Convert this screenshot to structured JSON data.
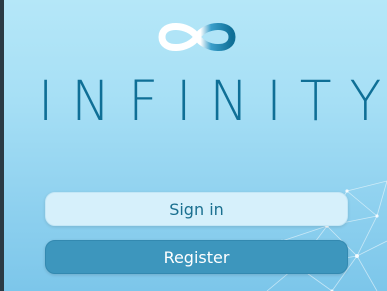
{
  "brand": {
    "logo_icon": "infinity-logo-icon",
    "name": "INFINITY"
  },
  "buttons": {
    "sign_in": "Sign in",
    "register": "Register"
  },
  "decor": {
    "background_icon": "network-mesh-icon"
  },
  "colors": {
    "background_top": "#b5e7f8",
    "background_bottom": "#7cc6ea",
    "sign_in_bg": "#d6f0fb",
    "register_bg": "#3d96bd"
  }
}
